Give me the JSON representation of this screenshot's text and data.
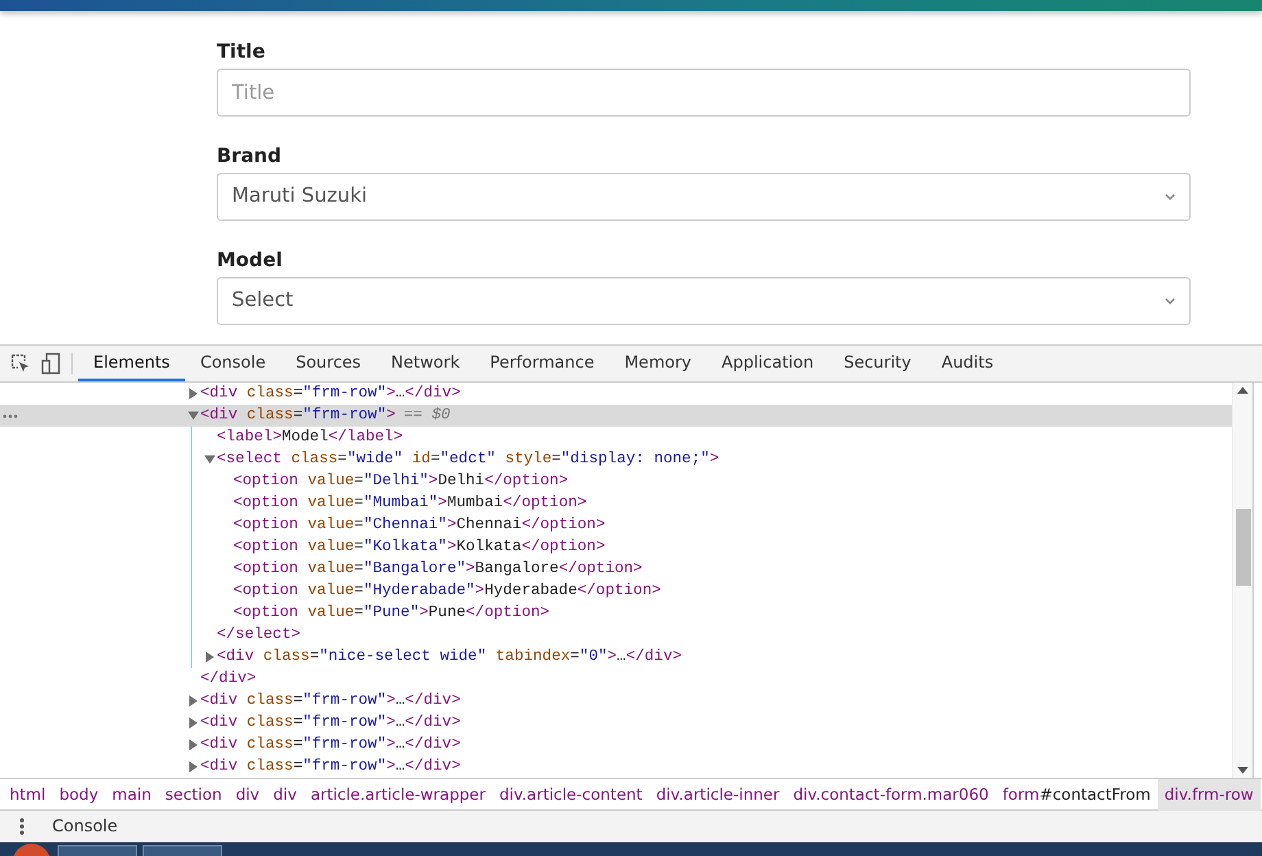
{
  "form": {
    "fields": [
      {
        "label": "Title",
        "kind": "text",
        "placeholder": "Title"
      },
      {
        "label": "Brand",
        "kind": "select",
        "value": "Maruti Suzuki"
      },
      {
        "label": "Model",
        "kind": "select",
        "value": "Select"
      }
    ]
  },
  "devtools": {
    "tabs": [
      {
        "label": "Elements",
        "selected": true
      },
      {
        "label": "Console",
        "selected": false
      },
      {
        "label": "Sources",
        "selected": false
      },
      {
        "label": "Network",
        "selected": false
      },
      {
        "label": "Performance",
        "selected": false
      },
      {
        "label": "Memory",
        "selected": false
      },
      {
        "label": "Application",
        "selected": false
      },
      {
        "label": "Security",
        "selected": false
      },
      {
        "label": "Audits",
        "selected": false
      }
    ],
    "elements_tree": [
      {
        "text": "<div class=\"frm-row\">…</div>",
        "expanded": false,
        "selected": false
      },
      {
        "text": "<div class=\"frm-row\">",
        "note": "== $0",
        "expanded": true,
        "selected": true,
        "close": "</div>",
        "children": [
          {
            "text": "<label>Model</label>",
            "selected": false
          },
          {
            "text": "<select class=\"wide\" id=\"edct\" style=\"display: none;\">",
            "expanded": true,
            "selected": false,
            "close": "</select>",
            "children": [
              {
                "text": "<option value=\"Delhi\">Delhi</option>",
                "selected": false
              },
              {
                "text": "<option value=\"Mumbai\">Mumbai</option>",
                "selected": false
              },
              {
                "text": "<option value=\"Chennai\">Chennai</option>",
                "selected": false
              },
              {
                "text": "<option value=\"Kolkata\">Kolkata</option>",
                "selected": false
              },
              {
                "text": "<option value=\"Bangalore\">Bangalore</option>",
                "selected": false
              },
              {
                "text": "<option value=\"Hyderabade\">Hyderabade</option>",
                "selected": false
              },
              {
                "text": "<option value=\"Pune\">Pune</option>",
                "selected": false
              }
            ]
          },
          {
            "text": "<div class=\"nice-select wide\" tabindex=\"0\">…</div>",
            "expanded": false,
            "selected": false
          }
        ]
      },
      {
        "text": "<div class=\"frm-row\">…</div>",
        "expanded": false,
        "selected": false
      },
      {
        "text": "<div class=\"frm-row\">…</div>",
        "expanded": false,
        "selected": false
      },
      {
        "text": "<div class=\"frm-row\">…</div>",
        "expanded": false,
        "selected": false
      },
      {
        "text": "<div class=\"frm-row\">…</div>",
        "expanded": false,
        "selected": false
      }
    ],
    "breadcrumbs": [
      {
        "tag": "html",
        "selected": false
      },
      {
        "tag": "body",
        "selected": false
      },
      {
        "tag": "main",
        "selected": false
      },
      {
        "tag": "section",
        "selected": false
      },
      {
        "tag": "div",
        "selected": false
      },
      {
        "tag": "div",
        "selected": false
      },
      {
        "tag": "article",
        "suffix": ".article-wrapper",
        "selected": false
      },
      {
        "tag": "div",
        "suffix": ".article-content",
        "selected": false
      },
      {
        "tag": "div",
        "suffix": ".article-inner",
        "selected": false
      },
      {
        "tag": "div",
        "suffix": ".contact-form.mar060",
        "selected": false
      },
      {
        "tag": "form",
        "suffix": "#contactFrom",
        "selected": false
      },
      {
        "tag": "div",
        "suffix": ".frm-row",
        "selected": true
      }
    ],
    "drawer_tab": "Console"
  }
}
